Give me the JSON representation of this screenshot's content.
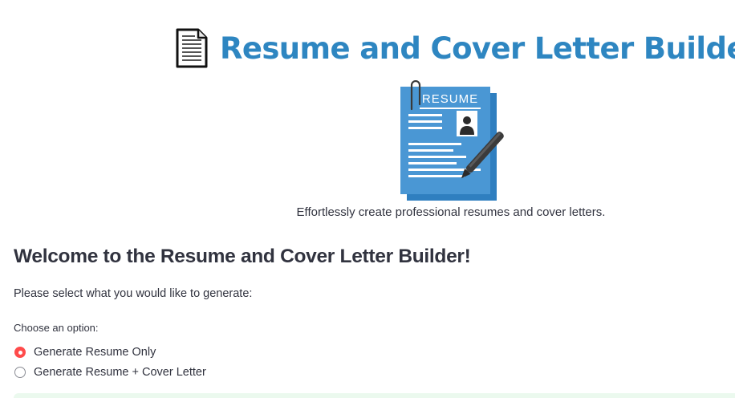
{
  "header": {
    "icon": "document-icon",
    "title": "Resume and Cover Letter Builder"
  },
  "hero": {
    "icon": "resume-illustration",
    "card_label": "RESUME"
  },
  "tagline": "Effortlessly create professional resumes and cover letters.",
  "welcome": {
    "heading": "Welcome to the Resume and Cover Letter Builder!",
    "prompt": "Please select what you would like to generate:"
  },
  "options": {
    "label": "Choose an option:",
    "items": [
      {
        "label": "Generate Resume Only",
        "selected": true
      },
      {
        "label": "Generate Resume + Cover Letter",
        "selected": false
      }
    ]
  },
  "colors": {
    "title": "#2e86c1",
    "accent": "#ff4b4b",
    "success_bg": "#ebf9ee",
    "text": "#31333f"
  }
}
